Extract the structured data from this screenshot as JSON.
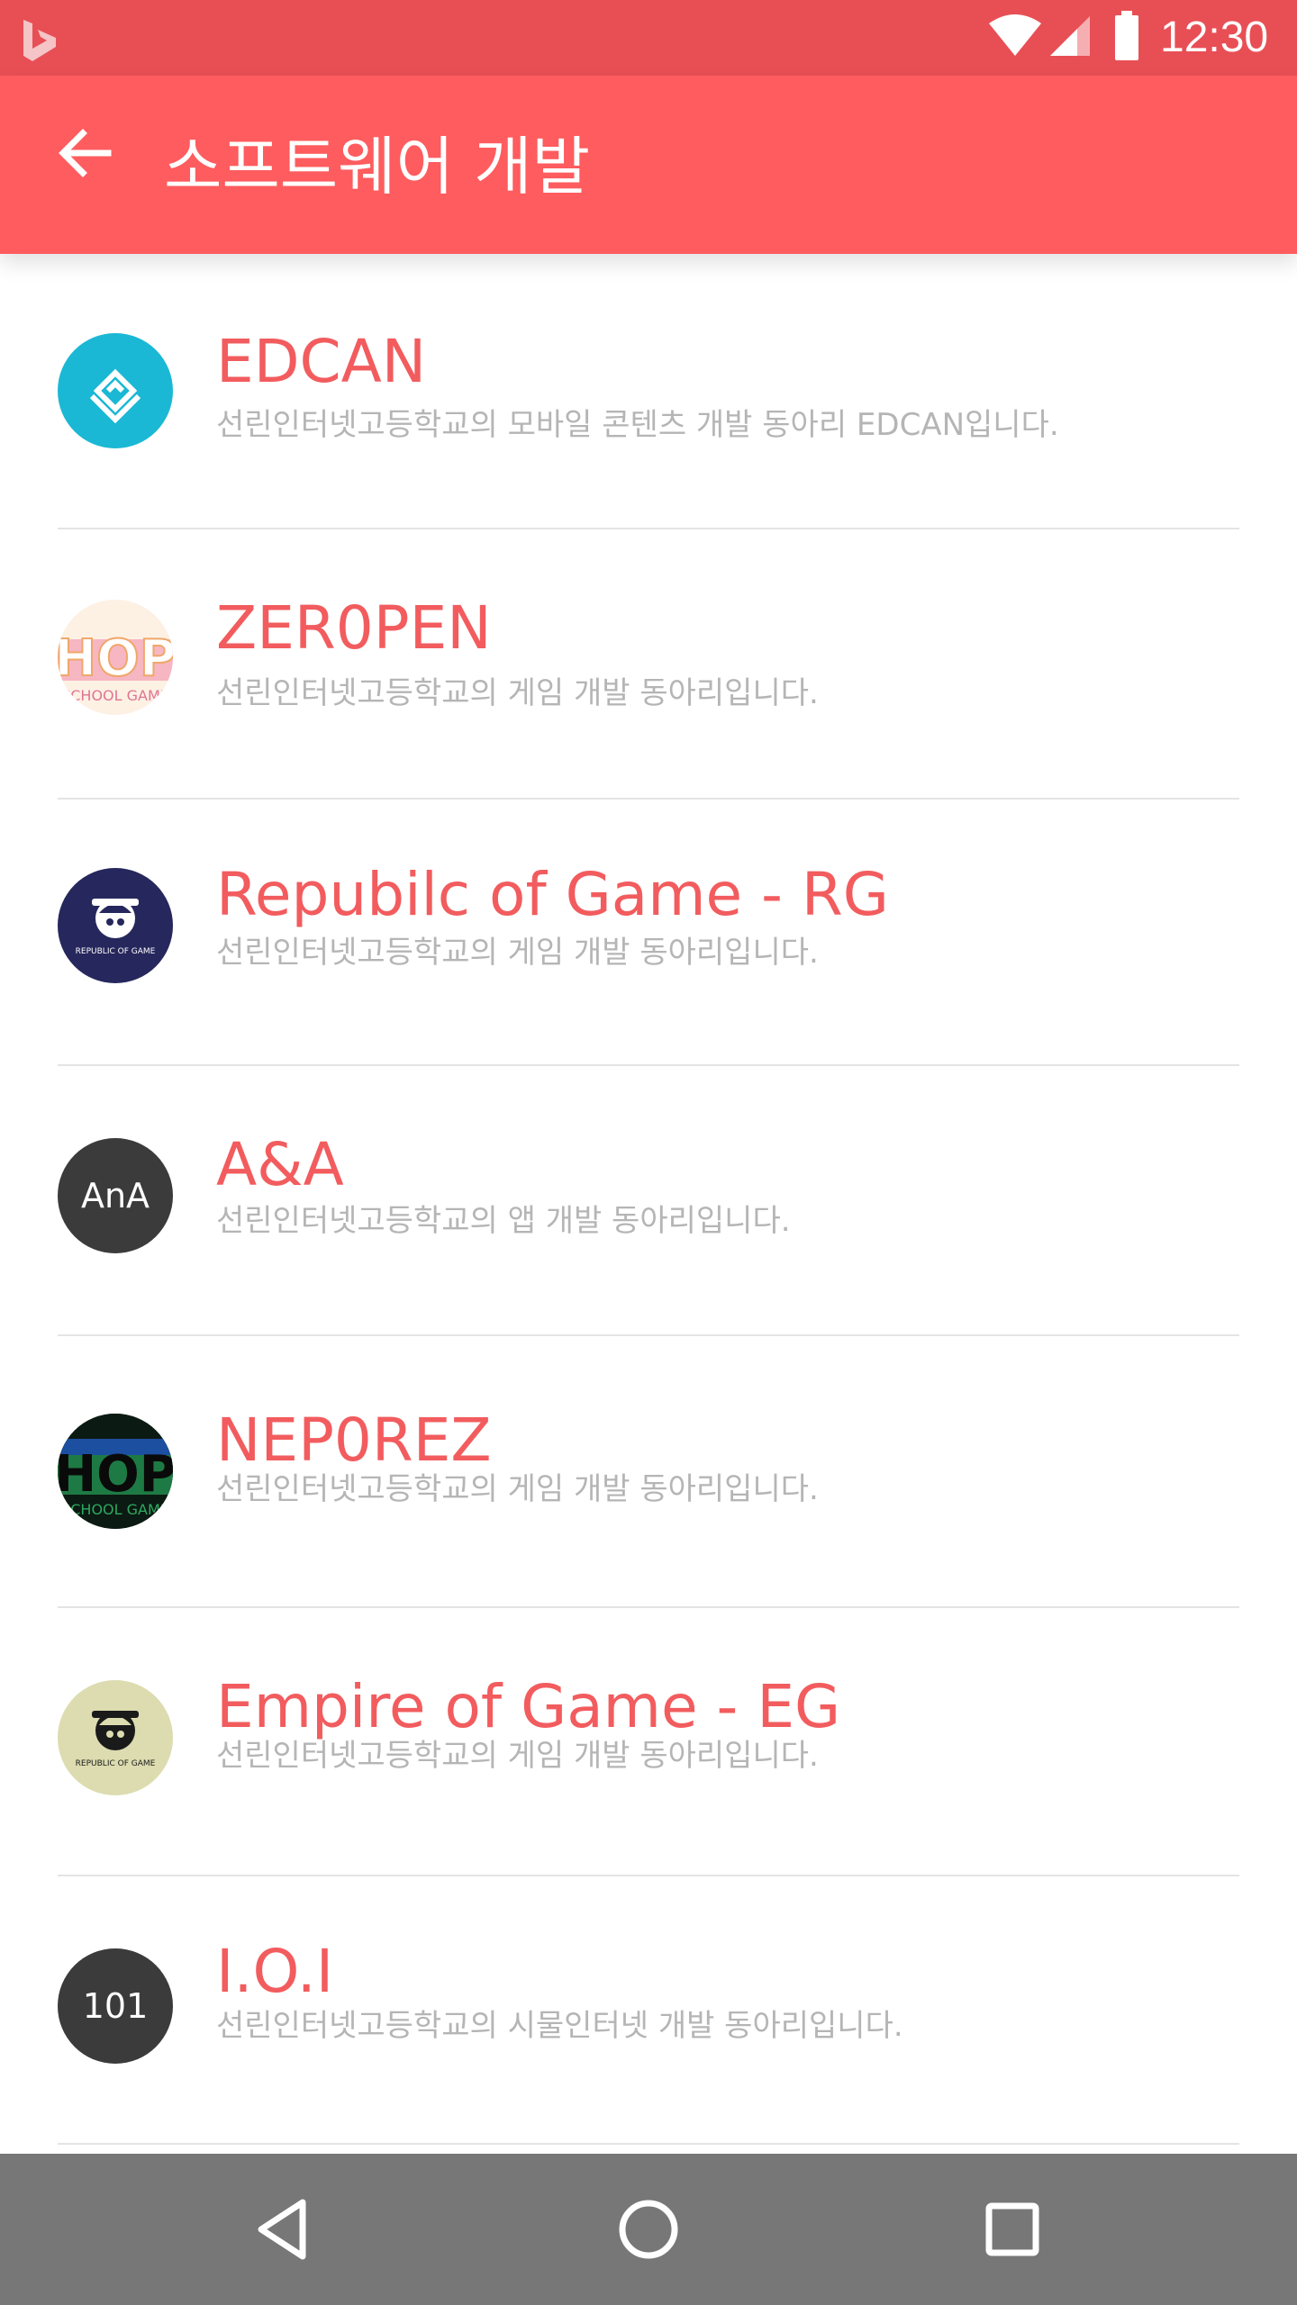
{
  "status_bar": {
    "time": "12:30",
    "icons": [
      "bing-logo",
      "wifi-icon",
      "signal-icon",
      "battery-icon"
    ]
  },
  "app_bar": {
    "title": "소프트웨어 개발",
    "back_icon": "arrow-left-icon"
  },
  "colors": {
    "status_bar": "#e84f55",
    "app_bar": "#fe5c5e",
    "item_title": "#f25c5e",
    "item_desc": "#b5b5b5",
    "nav_bar": "#777777"
  },
  "clubs": [
    {
      "title": "EDCAN",
      "desc": "선린인터넷고등학교의 모바일 콘텐츠 개발 동아리 EDCAN입니다.",
      "avatar": "edcan-logo"
    },
    {
      "title": "ZER0PEN",
      "desc": "선린인터넷고등학교의 게임 개발 동아리입니다.",
      "avatar": "hop-school-game-logo"
    },
    {
      "title": "Repubilc of Game - RG",
      "desc": "선린인터넷고등학교의 게임 개발 동아리입니다.",
      "avatar": "republic-of-game-logo",
      "avatar_caption": "REPUBLIC OF GAME"
    },
    {
      "title": "A&A",
      "desc": "선린인터넷고등학교의 앱 개발 동아리입니다.",
      "avatar": "text-avatar",
      "avatar_text": "AnA"
    },
    {
      "title": "NEP0REZ",
      "desc": "선린인터넷고등학교의 게임 개발 동아리입니다.",
      "avatar": "hop-school-game-logo-dark"
    },
    {
      "title": "Empire of Game - EG",
      "desc": "선린인터넷고등학교의 게임 개발 동아리입니다.",
      "avatar": "republic-of-game-logo-light",
      "avatar_caption": "REPUBLIC OF GAME"
    },
    {
      "title": "I.O.I",
      "desc": "선린인터넷고등학교의 시물인터넷 개발 동아리입니다.",
      "avatar": "text-avatar",
      "avatar_text": "101"
    }
  ],
  "nav_bar": {
    "icons": [
      "back-triangle-icon",
      "home-circle-icon",
      "recents-square-icon"
    ]
  }
}
